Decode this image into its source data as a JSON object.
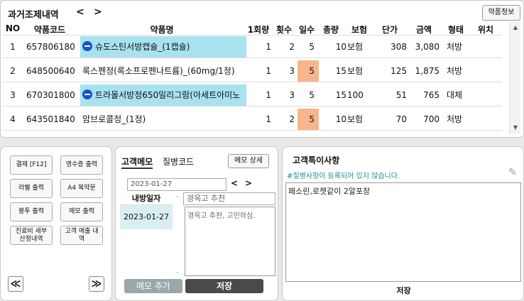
{
  "header": {
    "title": "과거조제내역",
    "prev_arrow": "<",
    "next_arrow": ">",
    "drug_info_button": "약품정보"
  },
  "table": {
    "columns": [
      "NO",
      "약품코드",
      "약품명",
      "1회량",
      "횟수",
      "일수",
      "총량",
      "보험",
      "단가",
      "금액",
      "형태",
      "위치"
    ],
    "rows": [
      {
        "no": "1",
        "code": "657806180",
        "name": "슈도스틴서방캡슐_(1캡슐)",
        "dose": "1",
        "times": "2",
        "days": "5",
        "total": "10",
        "insurance": "보험",
        "unit_price": "308",
        "amount": "3,080",
        "type": "처방",
        "location": "",
        "has_dot": true,
        "name_highlight": true,
        "days_highlight": false
      },
      {
        "no": "2",
        "code": "648500640",
        "name": "록스펜정(록소프로펜나트륨)_(60mg/1정)",
        "dose": "1",
        "times": "3",
        "days": "5",
        "total": "15",
        "insurance": "보험",
        "unit_price": "125",
        "amount": "1,875",
        "type": "처방",
        "location": "",
        "has_dot": false,
        "name_highlight": false,
        "days_highlight": true
      },
      {
        "no": "3",
        "code": "670301800",
        "name": "트라몰서방정650밀리그람(아세트아미노",
        "dose": "1",
        "times": "3",
        "days": "5",
        "total": "15",
        "insurance": "100",
        "unit_price": "51",
        "amount": "765",
        "type": "대체",
        "location": "",
        "has_dot": true,
        "name_highlight": true,
        "days_highlight": false
      },
      {
        "no": "4",
        "code": "643501840",
        "name": "암브로콜정_(1정)",
        "dose": "1",
        "times": "2",
        "days": "5",
        "total": "10",
        "insurance": "보험",
        "unit_price": "70",
        "amount": "700",
        "type": "처방",
        "location": "",
        "has_dot": false,
        "name_highlight": false,
        "days_highlight": true
      }
    ]
  },
  "actions": {
    "payment": "결제 [F12]",
    "receipt_print": "영수증 출력",
    "label_print": "라벨 출력",
    "a4_guide": "A4 복약문",
    "envelope_print": "봉투 출력",
    "memo_print": "메모 출력",
    "fee_detail": "진료비 세부 산정내역",
    "customer_sales": "고객 매출 내역",
    "first_page": "≪",
    "last_page": "≫"
  },
  "memo": {
    "tab_customer_memo": "고객메모",
    "tab_disease_code": "질병코드",
    "memo_detail_button": "메모 상세",
    "date_value": "2023-01-27",
    "date_prev": "<",
    "date_next": ">",
    "list_header": "내방일자",
    "list_items": [
      "2023-01-27"
    ],
    "memo_title_value": "경옥고 추천",
    "memo_body_value": "경옥고 추천, 고민하심.",
    "add_memo_button": "메모 추가",
    "save_button": "저장"
  },
  "special_notes": {
    "title": "고객특이사항",
    "notice": "#질병사항이 등록되어 있지 않습니다.",
    "content": "페소린,로젯같이 2알포장",
    "save_label": "저장"
  },
  "colors": {
    "highlight_cyan": "#a9e2ef",
    "highlight_orange": "#f8b58c",
    "dot_blue": "#1554c8",
    "notice_teal": "#1a8f8f",
    "button_gray": "#9aa7ab",
    "button_dark": "#4a4a4a"
  }
}
